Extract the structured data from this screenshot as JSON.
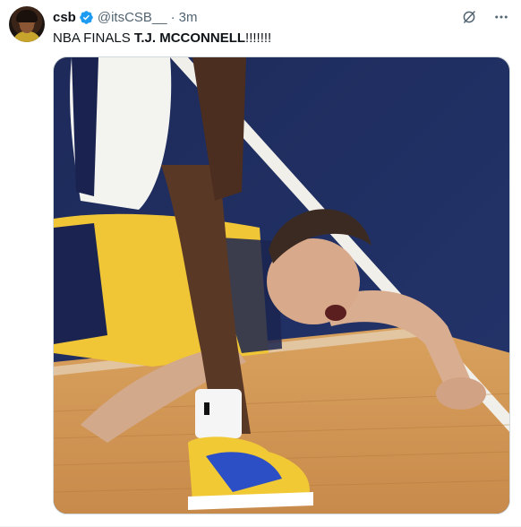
{
  "tweet": {
    "author": {
      "display_name": "csb",
      "handle": "@itsCSB__",
      "verified": true,
      "avatar_icon": "avatar-photo"
    },
    "separator": "·",
    "time": "3m",
    "text_plain": "NBA FINALS ",
    "text_bold": "T.J. MCCONNELL",
    "text_suffix": "!!!!!!!",
    "media": {
      "kind": "photo"
    },
    "actions": {
      "grok_icon": "grok-icon",
      "more_icon": "more-icon"
    }
  },
  "colors": {
    "verified_blue": "#1d9bf0",
    "secondary_text": "#536471",
    "primary_text": "#0f1419"
  }
}
